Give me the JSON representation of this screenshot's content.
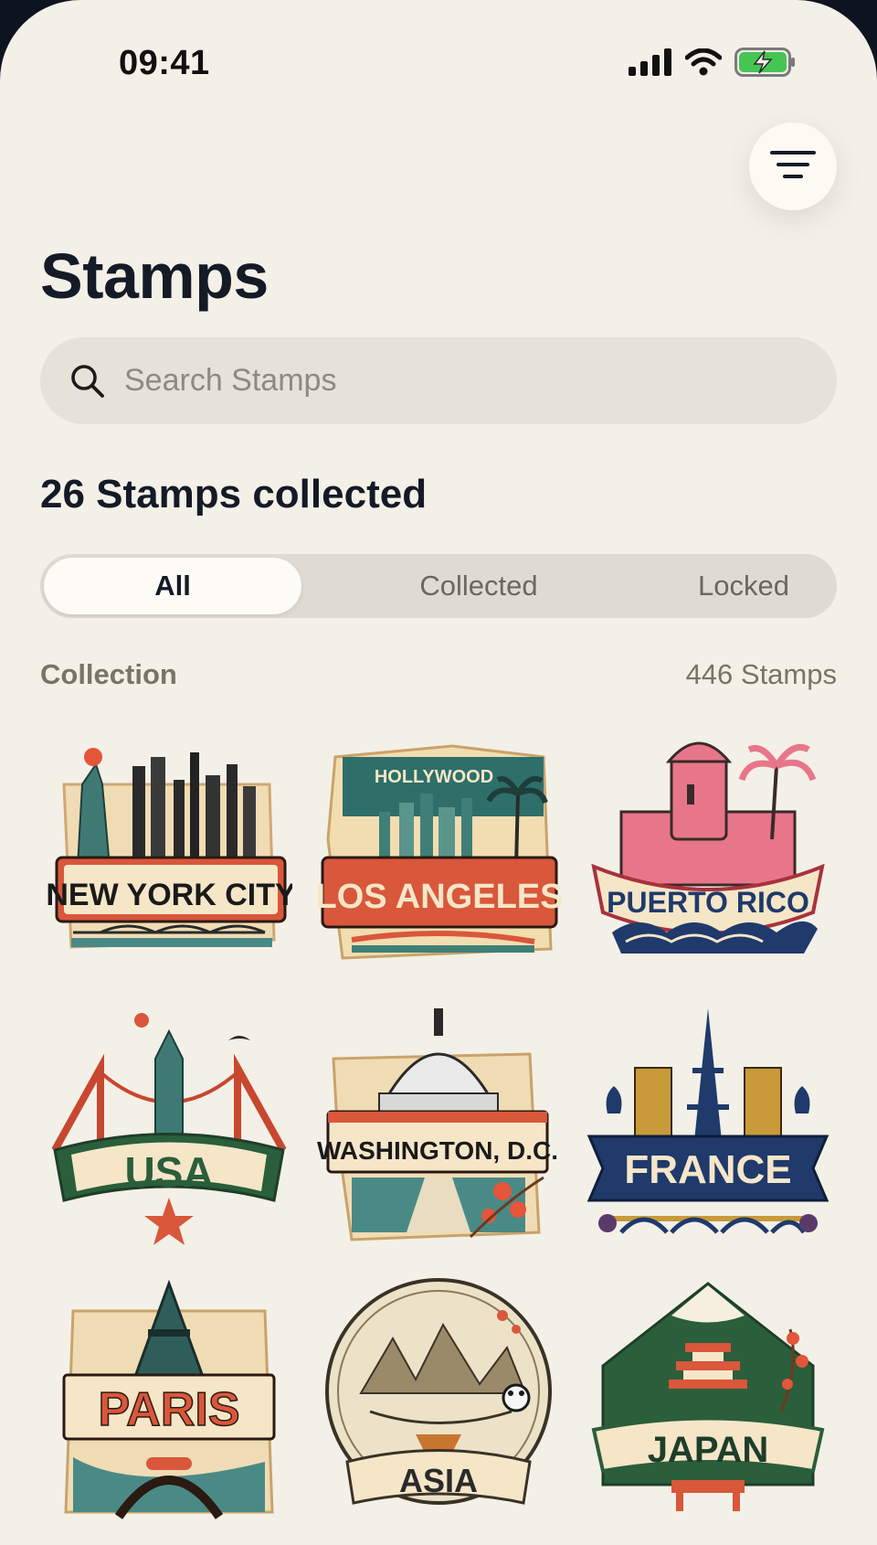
{
  "status_bar": {
    "time": "09:41"
  },
  "header": {
    "title": "Stamps"
  },
  "search": {
    "placeholder": "Search Stamps",
    "value": ""
  },
  "summary": {
    "collected_label": "26 Stamps collected"
  },
  "tabs": [
    {
      "label": "All",
      "selected": true
    },
    {
      "label": "Collected",
      "selected": false
    },
    {
      "label": "Locked",
      "selected": false
    }
  ],
  "collection": {
    "label": "Collection",
    "count_label": "446 Stamps"
  },
  "stamps": [
    {
      "label": "NEW YORK CITY"
    },
    {
      "label": "LOS ANGELES",
      "sublabel": "HOLLYWOOD"
    },
    {
      "label": "PUERTO RICO"
    },
    {
      "label": "USA"
    },
    {
      "label": "WASHINGTON, D.C."
    },
    {
      "label": "FRANCE"
    },
    {
      "label": "PARIS"
    },
    {
      "label": "ASIA"
    },
    {
      "label": "JAPAN"
    }
  ],
  "colors": {
    "background": "#f3f0e8",
    "text_primary": "#141a26",
    "stamp_red": "#d9573b",
    "stamp_teal": "#2f6f6a",
    "stamp_navy": "#1f3a6b",
    "stamp_cream": "#f5e6c8"
  }
}
